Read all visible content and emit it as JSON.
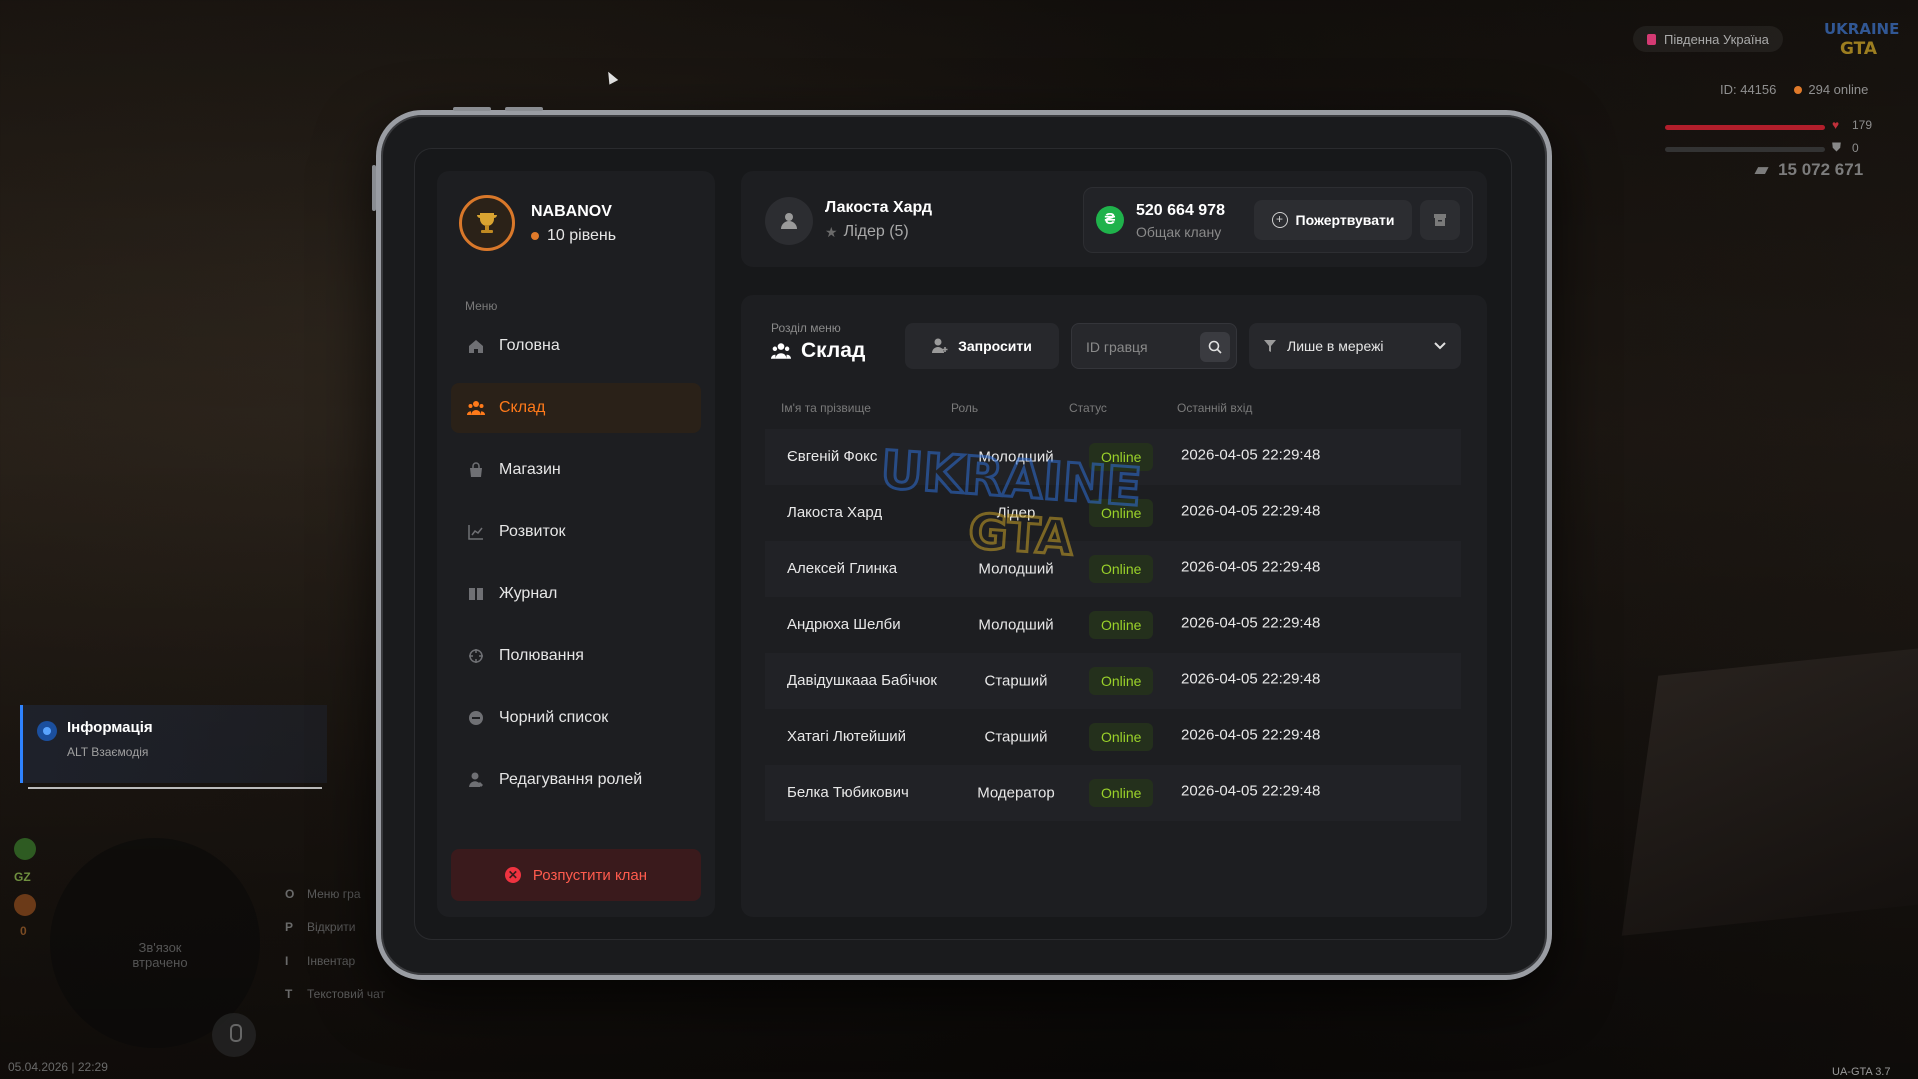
{
  "hud": {
    "server": "Південна Україна",
    "id_text": "ID: 44156",
    "online_text": "294 online",
    "health": "179",
    "armor": "0",
    "money": "15 072 671",
    "datetime": "05.04.2026 | 22:29",
    "version": "UA-GTA 3.7",
    "connection_lost": "Зв'язок втрачено",
    "mini_label_1": "GZ",
    "mini_label_2": "0",
    "hints": [
      {
        "key": "O",
        "label": "Меню гра"
      },
      {
        "key": "P",
        "label": "Відкрити"
      },
      {
        "key": "I",
        "label": "Інвентар"
      },
      {
        "key": "T",
        "label": "Текстовий чат"
      }
    ]
  },
  "info": {
    "title": "Інформація",
    "subtitle": "ALT Взаємодія"
  },
  "profile": {
    "name": "NABANOV",
    "level": "10 рівень"
  },
  "menu_label": "Меню",
  "menu": [
    {
      "label": "Головна",
      "icon": "home-icon"
    },
    {
      "label": "Склад",
      "icon": "users-icon",
      "active": true
    },
    {
      "label": "Магазин",
      "icon": "shop-icon"
    },
    {
      "label": "Розвиток",
      "icon": "chart-icon"
    },
    {
      "label": "Журнал",
      "icon": "book-icon"
    },
    {
      "label": "Полювання",
      "icon": "crosshair-icon"
    },
    {
      "label": "Чорний список",
      "icon": "block-icon"
    },
    {
      "label": "Редагування ролей",
      "icon": "user-edit-icon"
    }
  ],
  "disband_label": "Розпустити клан",
  "header": {
    "name": "Лакоста Хард",
    "role": "Лідер (5)",
    "bank_amount": "520 664 978",
    "bank_label": "Общак клану",
    "donate_label": "Пожертвувати"
  },
  "section": {
    "label": "Розділ меню",
    "title": "Склад",
    "invite_label": "Запросити",
    "search_placeholder": "ID гравця",
    "filter_label": "Лише в мережі"
  },
  "table": {
    "headers": [
      "Ім'я та прізвище",
      "Роль",
      "Статус",
      "Останній вхід"
    ],
    "rows": [
      {
        "name": "Євгеній Фокс",
        "role": "Молодший",
        "status": "Online",
        "last": "2026-04-05 22:29:48"
      },
      {
        "name": "Лакоста Хард",
        "role": "Лідер",
        "status": "Online",
        "last": "2026-04-05 22:29:48"
      },
      {
        "name": "Алексей Глинка",
        "role": "Молодший",
        "status": "Online",
        "last": "2026-04-05 22:29:48"
      },
      {
        "name": "Андрюха Шелби",
        "role": "Молодший",
        "status": "Online",
        "last": "2026-04-05 22:29:48"
      },
      {
        "name": "Давідушкааа Бабічюк",
        "role": "Старший",
        "status": "Online",
        "last": "2026-04-05 22:29:48"
      },
      {
        "name": "Хатагі Лютейший",
        "role": "Старший",
        "status": "Online",
        "last": "2026-04-05 22:29:48"
      },
      {
        "name": "Белка Тюбикович",
        "role": "Модератор",
        "status": "Online",
        "last": "2026-04-05 22:29:48"
      }
    ]
  },
  "colors": {
    "accent": "#ff7a1a",
    "online": "#9ad12a",
    "danger": "#ef3340",
    "money": "#1fb24b"
  }
}
